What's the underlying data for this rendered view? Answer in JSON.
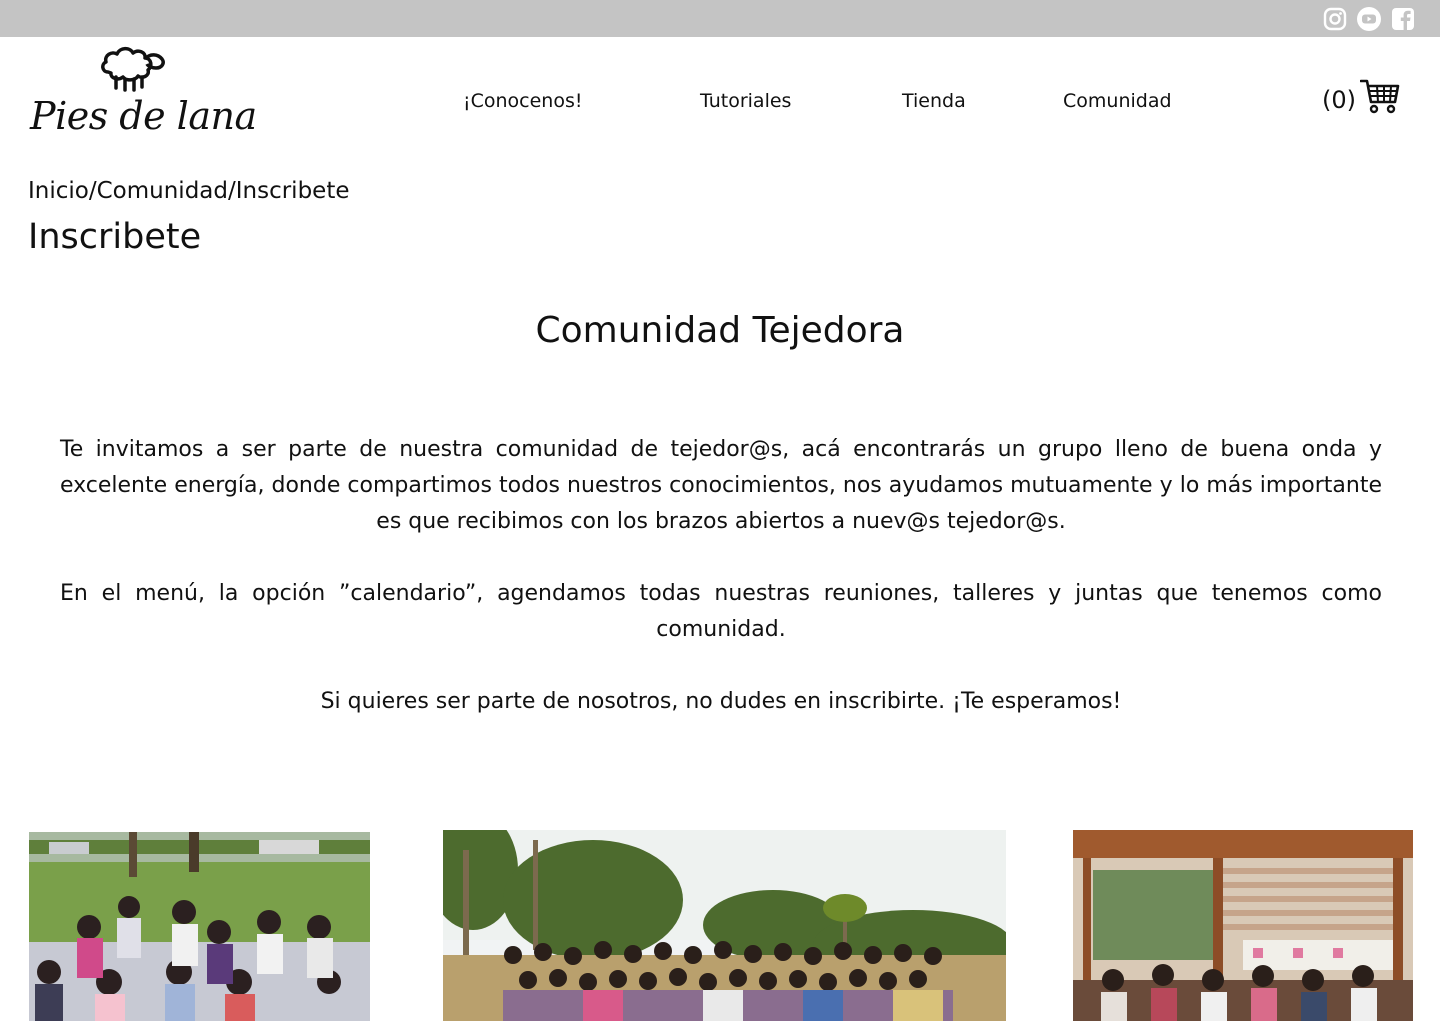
{
  "topbar": {
    "social": [
      "instagram-icon",
      "youtube-icon",
      "facebook-icon"
    ]
  },
  "brand": {
    "name": "Pies de lana"
  },
  "nav": {
    "items": [
      {
        "label": "¡Conocenos!"
      },
      {
        "label": "Tutoriales"
      },
      {
        "label": "Tienda"
      },
      {
        "label": "Comunidad"
      }
    ],
    "cart_count": "(0)"
  },
  "breadcrumb": {
    "items": [
      "Inicio",
      "Comunidad",
      "Inscribete"
    ],
    "separator": "/"
  },
  "page": {
    "title": "Inscribete",
    "section_title": "Comunidad Tejedora",
    "paragraphs": [
      "Te invitamos a ser parte de nuestra comunidad de tejedor@s, acá encontrarás un grupo lleno de buena onda y excelente energía, donde compartimos todos nuestros conocimientos, nos ayudamos mutuamente y lo más importante es que recibimos con los brazos abiertos a nuev@s tejedor@s.",
      "En el menú, la opción ”calendario”, agendamos todas nuestras reuniones, talleres y juntas que tenemos como comunidad.",
      "Si quieres ser parte de nosotros, no dudes en inscribirte. ¡Te esperamos!"
    ]
  },
  "colors": {
    "topbar": "#c4c4c4",
    "text": "#111111",
    "background": "#ffffff"
  }
}
